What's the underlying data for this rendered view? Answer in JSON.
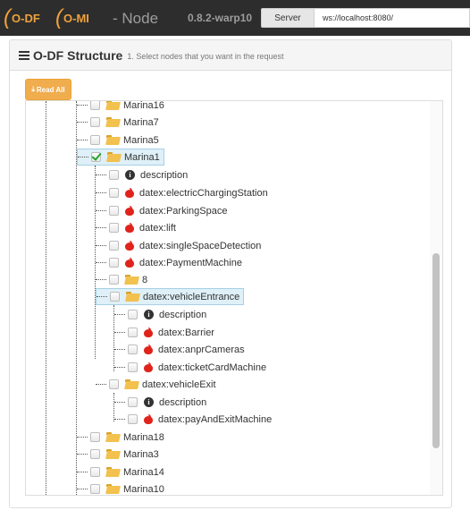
{
  "navbar": {
    "brand_odf": "O-DF",
    "brand_omi": "O-MI",
    "node_label": "- Node",
    "version": "0.8.2-warp10",
    "server_button": "Server",
    "server_url": "ws://localhost:8080/"
  },
  "panel": {
    "title": "O-DF Structure",
    "hint": "1. Select nodes that you want in the request",
    "read_all": "Read All"
  },
  "tree": {
    "marina16": "Marina16",
    "marina7": "Marina7",
    "marina5": "Marina5",
    "marina1": "Marina1",
    "m1_description": "description",
    "m1_charging": "datex:electricChargingStation",
    "m1_parking": "datex:ParkingSpace",
    "m1_lift": "datex:lift",
    "m1_single": "datex:singleSpaceDetection",
    "m1_payment": "datex:PaymentMachine",
    "m1_eight": "8",
    "vehicle_entrance": "datex:vehicleEntrance",
    "ve_description": "description",
    "ve_barrier": "datex:Barrier",
    "ve_anpr": "datex:anprCameras",
    "ve_ticket": "datex:ticketCardMachine",
    "vehicle_exit": "datex:vehicleExit",
    "vx_description": "description",
    "vx_payandexit": "datex:payAndExitMachine",
    "marina18": "Marina18",
    "marina3": "Marina3",
    "marina14": "Marina14",
    "marina10": "Marina10"
  },
  "icons": {
    "folder": "folder-open-icon",
    "info": "info-circle-icon",
    "apple": "apple-icon",
    "list": "list-icon",
    "download": "download-icon"
  },
  "colors": {
    "navbar": "#2d2d2d",
    "brand": "#f0a13c",
    "read_all": "#f0ad4e",
    "checked": "#27a329",
    "selected_bg": "#dff0f8"
  }
}
